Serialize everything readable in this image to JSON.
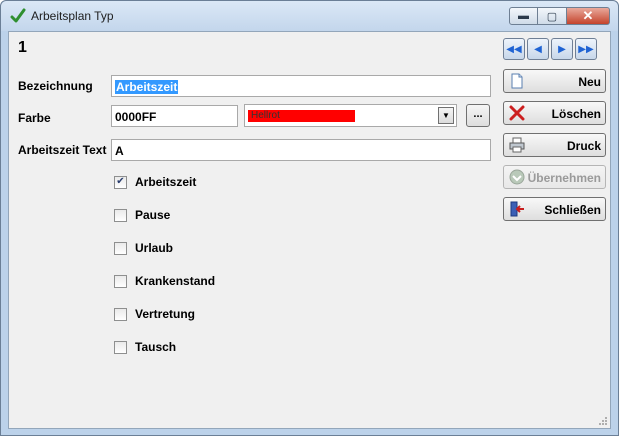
{
  "window": {
    "title": "Arbeitsplan Typ",
    "min_label": "▬",
    "max_label": "▢",
    "close_label": "✕",
    "title_icon_color": "#2f8f2f"
  },
  "record": {
    "number": "1"
  },
  "form": {
    "bezeichnung_label": "Bezeichnung",
    "bezeichnung_value": "Arbeitszeit",
    "farbe_label": "Farbe",
    "farbe_value": "0000FF",
    "farbe_combo_value": "Hellrot",
    "farbe_combo_color": "#ff0000",
    "farbe_more_label": "...",
    "text_label": "Arbeitszeit Text",
    "text_value": "A"
  },
  "checkboxes": [
    {
      "label": "Arbeitszeit",
      "checked": true
    },
    {
      "label": "Pause",
      "checked": false
    },
    {
      "label": "Urlaub",
      "checked": false
    },
    {
      "label": "Krankenstand",
      "checked": false
    },
    {
      "label": "Vertretung",
      "checked": false
    },
    {
      "label": "Tausch",
      "checked": false
    }
  ],
  "nav": {
    "first": "◀◀",
    "prev": "◀",
    "next": "▶",
    "last": "▶▶"
  },
  "actions": {
    "neu": "Neu",
    "loeschen": "Löschen",
    "druck": "Druck",
    "uebernehmen": "Übernehmen",
    "schliessen": "Schließen"
  }
}
